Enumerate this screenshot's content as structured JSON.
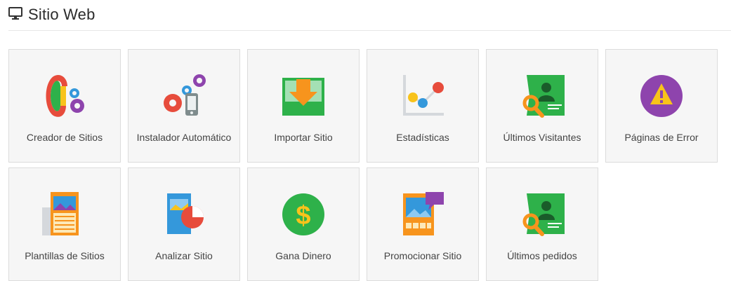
{
  "header": {
    "title": "Sitio Web",
    "icon": "monitor-icon"
  },
  "tiles": [
    {
      "label": "Creador de Sitios",
      "icon": "site-builder-icon"
    },
    {
      "label": "Instalador Automático",
      "icon": "auto-installer-icon"
    },
    {
      "label": "Importar Sitio",
      "icon": "import-site-icon"
    },
    {
      "label": "Estadísticas",
      "icon": "statistics-icon"
    },
    {
      "label": "Últimos Visitantes",
      "icon": "visitors-icon"
    },
    {
      "label": "Páginas de Error",
      "icon": "error-pages-icon"
    },
    {
      "label": "Plantillas de Sitios",
      "icon": "templates-icon"
    },
    {
      "label": "Analizar Sitio",
      "icon": "analyze-site-icon"
    },
    {
      "label": "Gana Dinero",
      "icon": "money-icon"
    },
    {
      "label": "Promocionar Sitio",
      "icon": "promote-site-icon"
    },
    {
      "label": "Últimos pedidos",
      "icon": "orders-icon"
    }
  ],
  "colors": {
    "green": "#2eb14a",
    "orange": "#f7941d",
    "purple": "#8e44ad",
    "red": "#e74c3c",
    "blue": "#3498db",
    "yellow": "#f8c31b"
  }
}
